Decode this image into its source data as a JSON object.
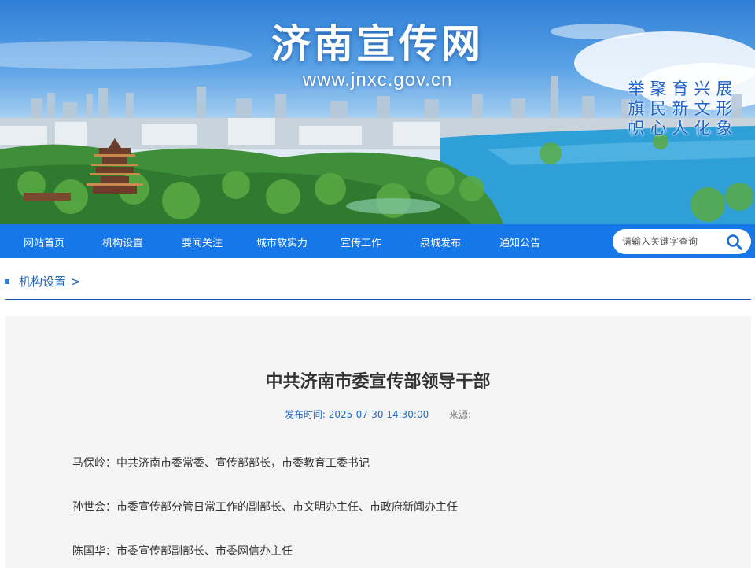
{
  "banner": {
    "site_title": "济南宣传网",
    "site_url": "www.jnxc.gov.cn",
    "slogan_columns": [
      [
        "举",
        "旗",
        "帜"
      ],
      [
        "聚",
        "民",
        "心"
      ],
      [
        "育",
        "新",
        "人"
      ],
      [
        "兴",
        "文",
        "化"
      ],
      [
        "展",
        "形",
        "象"
      ]
    ]
  },
  "nav": {
    "items": [
      "网站首页",
      "机构设置",
      "要闻关注",
      "城市软实力",
      "宣传工作",
      "泉城发布",
      "通知公告"
    ],
    "search_placeholder": "请输入关键字查询",
    "search_icon": "magnifier-icon"
  },
  "breadcrumb": {
    "label": "机构设置",
    "separator": ">"
  },
  "article": {
    "title": "中共济南市委宣传部领导干部",
    "publish_label": "发布时间:",
    "publish_time": "2025-07-30 14:30:00",
    "source_label": "来源:",
    "paragraphs": [
      "马保岭：中共济南市委常委、宣传部部长，市委教育工委书记",
      "孙世会：市委宣传部分管日常工作的副部长、市文明办主任、市政府新闻办主任",
      "陈国华：市委宣传部副部长、市委网信办主任"
    ]
  },
  "colors": {
    "nav_bg": "#1677e8",
    "accent": "#1f5fb5",
    "article_bg": "#f5f5f5"
  }
}
